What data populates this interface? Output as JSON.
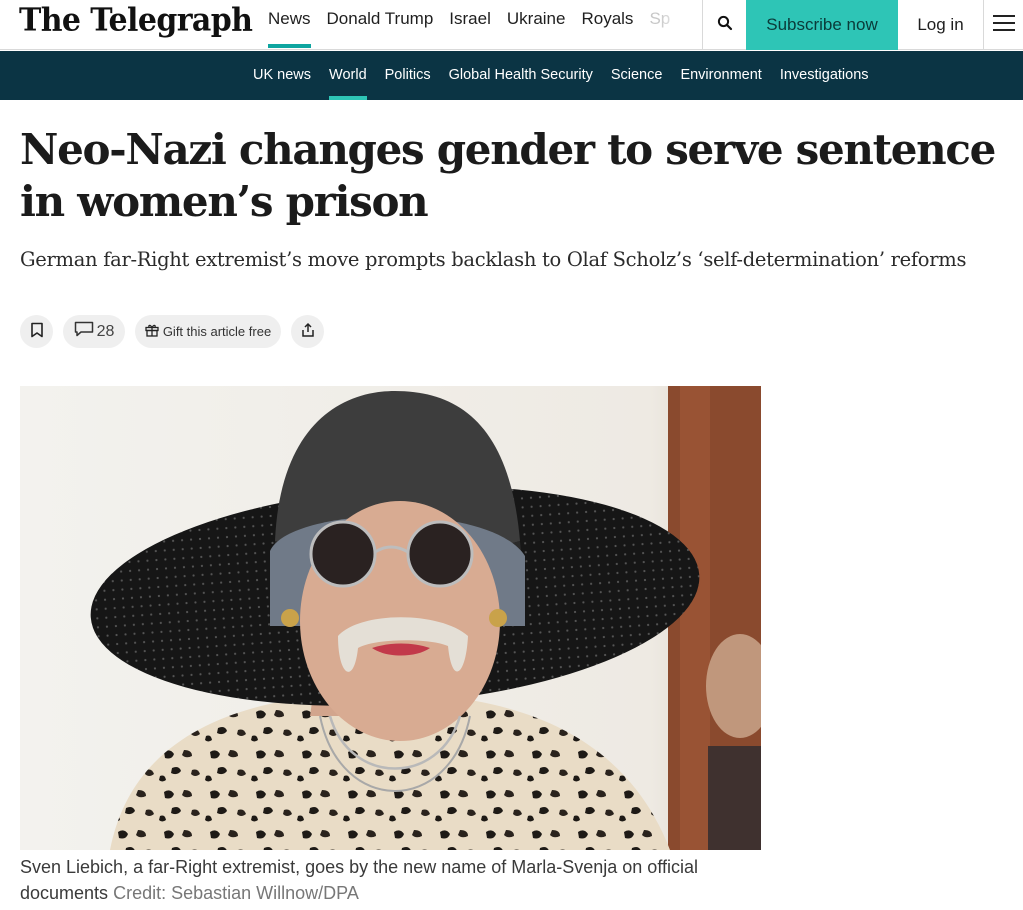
{
  "header": {
    "logo": "The Telegraph",
    "primary_nav": [
      "News",
      "Donald Trump",
      "Israel",
      "Ukraine",
      "Royals",
      "Sp"
    ],
    "subscribe_label": "Subscribe now",
    "login_label": "Log in"
  },
  "secondary_nav": [
    "UK news",
    "World",
    "Politics",
    "Global Health Security",
    "Science",
    "Environment",
    "Investigations"
  ],
  "article": {
    "headline": "Neo-Nazi changes gender to serve sentence in women’s prison",
    "standfirst": "German far-Right extremist’s move prompts backlash to Olaf Scholz’s ‘self-determination’ reforms",
    "comment_count": "28",
    "gift_label": "Gift this article free",
    "caption": "Sven Liebich, a far-Right extremist, goes by the new name of Marla-Svenja on official documents",
    "credit": "Credit: Sebastian Willnow/DPA"
  },
  "colors": {
    "accent_teal": "#2ec5b6",
    "nav_dark": "#0b3444"
  },
  "icons": [
    "search-icon",
    "hamburger-menu-icon",
    "bookmark-icon",
    "comment-icon",
    "gift-icon",
    "share-icon"
  ]
}
